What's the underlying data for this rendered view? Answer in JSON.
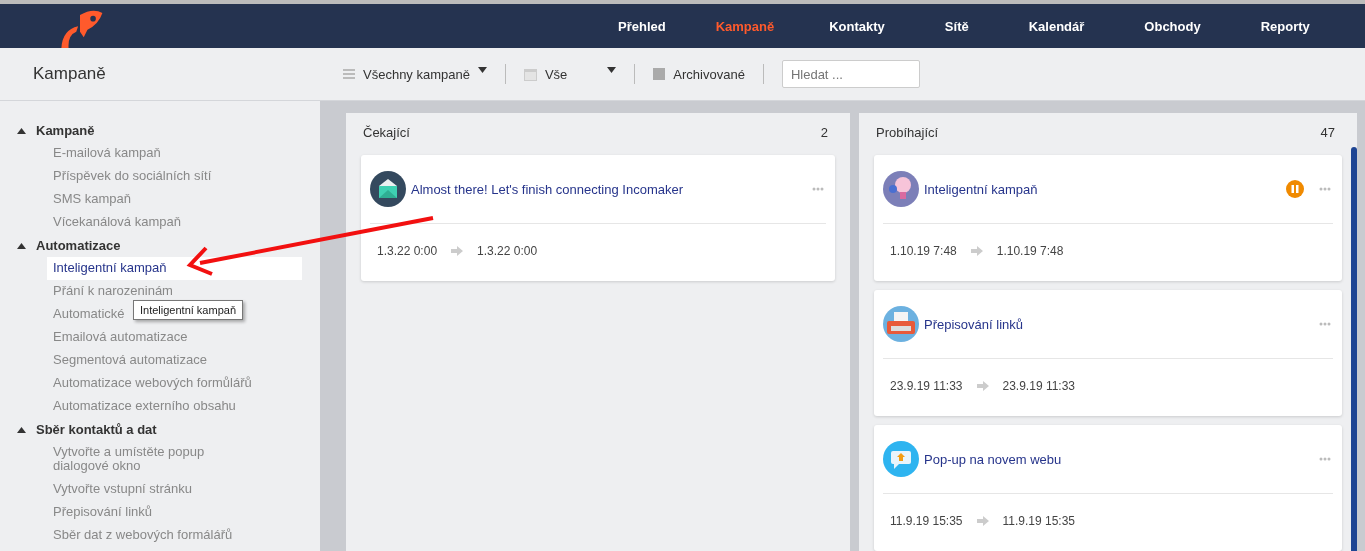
{
  "nav": [
    {
      "label": "Přehled",
      "selected": false
    },
    {
      "label": "Kampaně",
      "selected": true
    },
    {
      "label": "Kontakty",
      "selected": false
    },
    {
      "label": "Sítě",
      "selected": false
    },
    {
      "label": "Kalendář",
      "selected": false
    },
    {
      "label": "Obchody",
      "selected": false
    },
    {
      "label": "Reporty",
      "selected": false
    }
  ],
  "page_title": "Kampaně",
  "toolbar": {
    "filter": "Všechny kampaně",
    "date_range": "Vše",
    "archived": "Archivované",
    "search": {
      "placeholder": "Hledat ..."
    }
  },
  "sidebar": [
    {
      "label": "Kampaně",
      "expanded": true,
      "children": [
        {
          "label": "E-mailová kampaň",
          "selected": false
        },
        {
          "label": "Příspěvek do sociálních sítí",
          "selected": false
        },
        {
          "label": "SMS kampaň",
          "selected": false
        },
        {
          "label": "Vícekanálová kampaň",
          "selected": false
        }
      ]
    },
    {
      "label": "Automatizace",
      "expanded": true,
      "children": [
        {
          "label": "Inteligentní kampaň",
          "selected": true
        },
        {
          "label": "Přání k narozeninám",
          "selected": false
        },
        {
          "label": "Automatické",
          "selected": false
        },
        {
          "label": "Emailová automatizace",
          "selected": false
        },
        {
          "label": "Segmentová automatizace",
          "selected": false
        },
        {
          "label": "Automatizace webových formůlářů",
          "selected": false
        },
        {
          "label": "Automatizace externího obsahu",
          "selected": false
        }
      ]
    },
    {
      "label": "Sběr kontaktů a dat",
      "expanded": true,
      "children": [
        {
          "label": "Vytvořte a umístěte popup dialogové okno",
          "selected": false
        },
        {
          "label": "Vytvořte vstupní stránku",
          "selected": false
        },
        {
          "label": "Přepisování linků",
          "selected": false
        },
        {
          "label": "Sběr dat z webových formálářů",
          "selected": false
        }
      ]
    }
  ],
  "tooltip": "Inteligentní kampaň",
  "columns": [
    {
      "title": "Čekající",
      "count": "2",
      "cards": [
        {
          "kind": "envelope",
          "title": "Almost there! Let's finish connecting Incomaker",
          "paused": false,
          "start": "1.3.22 0:00",
          "end": "1.3.22 0:00"
        }
      ]
    },
    {
      "title": "Probíhající",
      "count": "47",
      "cards": [
        {
          "kind": "bulb",
          "title": "Inteligentní kampaň",
          "paused": true,
          "start": "1.10.19 7:48",
          "end": "1.10.19 7:48"
        },
        {
          "kind": "typewriter",
          "title": "Přepisování linků",
          "paused": false,
          "start": "23.9.19 11:33",
          "end": "23.9.19 11:33"
        },
        {
          "kind": "popup",
          "title": "Pop-up na novem webu",
          "paused": false,
          "start": "11.9.19 15:35",
          "end": "11.9.19 15:35"
        }
      ]
    }
  ]
}
